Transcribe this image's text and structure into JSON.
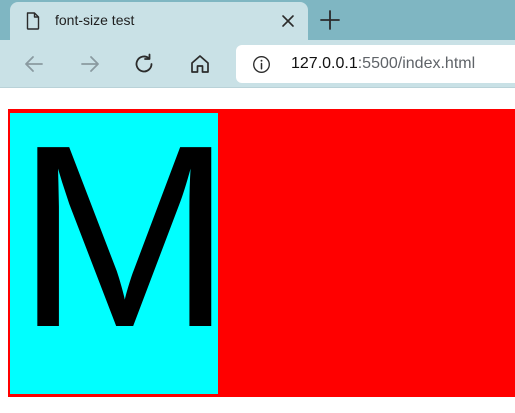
{
  "tab": {
    "title": "font-size test",
    "favicon": "document-icon",
    "close_icon": "close-icon"
  },
  "new_tab_icon": "plus-icon",
  "toolbar": {
    "back_icon": "arrow-left-icon",
    "forward_icon": "arrow-right-icon",
    "refresh_icon": "refresh-icon",
    "home_icon": "home-icon"
  },
  "address": {
    "info_icon": "info-icon",
    "host": "127.0.0.1",
    "rest": ":5500/index.html"
  },
  "page": {
    "letter": "M",
    "outer_color": "#ff0000",
    "inner_color": "#00ffff"
  },
  "colors": {
    "tabstrip": "#7fb6c2",
    "toolbar": "#c9e1e6"
  }
}
